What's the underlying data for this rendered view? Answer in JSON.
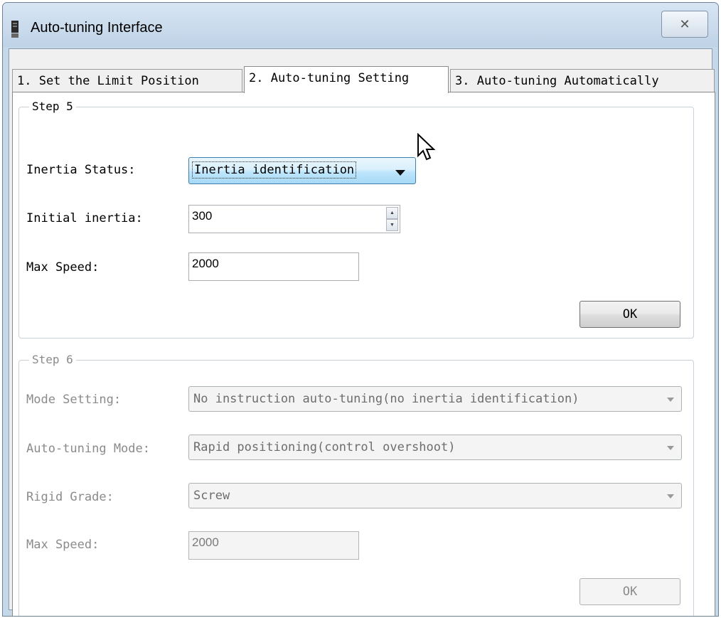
{
  "window": {
    "title": "Auto-tuning Interface",
    "close_glyph": "✕"
  },
  "tabs": [
    {
      "label": "1. Set the Limit Position",
      "active": false
    },
    {
      "label": "2. Auto-tuning Setting",
      "active": true
    },
    {
      "label": "3. Auto-tuning Automatically",
      "active": false
    }
  ],
  "step5": {
    "legend": "Step 5",
    "inertia_status_label": "Inertia Status:",
    "inertia_status_value": "Inertia identification",
    "initial_inertia_label": "Initial inertia:",
    "initial_inertia_value": "300",
    "max_speed_label": "Max Speed:",
    "max_speed_value": "2000",
    "ok_label": "OK"
  },
  "step6": {
    "legend": "Step 6",
    "mode_setting_label": "Mode Setting:",
    "mode_setting_value": "No instruction auto-tuning(no inertia identification)",
    "auto_tuning_mode_label": "Auto-tuning Mode:",
    "auto_tuning_mode_value": "Rapid positioning(control overshoot)",
    "rigid_grade_label": "Rigid Grade:",
    "rigid_grade_value": "Screw",
    "max_speed_label": "Max Speed:",
    "max_speed_value": "2000",
    "ok_label": "OK",
    "enabled": false
  },
  "colors": {
    "title_bar": "#c5d8ea",
    "highlight": "#3c7fb1",
    "disabled_text": "#8b8b8b"
  }
}
